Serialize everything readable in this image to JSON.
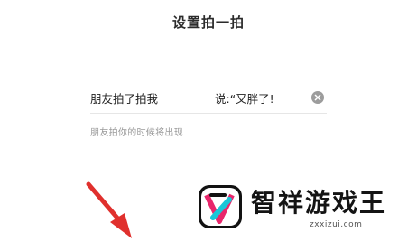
{
  "header": {
    "title": "设置拍一拍"
  },
  "pat_setting": {
    "prefix": "朋友拍了拍我",
    "suffix_value": "说:“又胖了!",
    "hint": "朋友拍你的时候将出现"
  },
  "icons": {
    "clear": "clear-circle-x-icon",
    "arrow": "red-arrow-icon",
    "logo": "zhixiang-logo-icon"
  },
  "watermark": {
    "brand_name": "智祥游戏王",
    "domain": "zxxizui.com"
  },
  "colors": {
    "arrow": "#e0302d",
    "logo_pink": "#e8266b",
    "logo_cyan": "#19c6d8",
    "divider": "#e6e6e6",
    "hint": "#9a9a9a"
  }
}
